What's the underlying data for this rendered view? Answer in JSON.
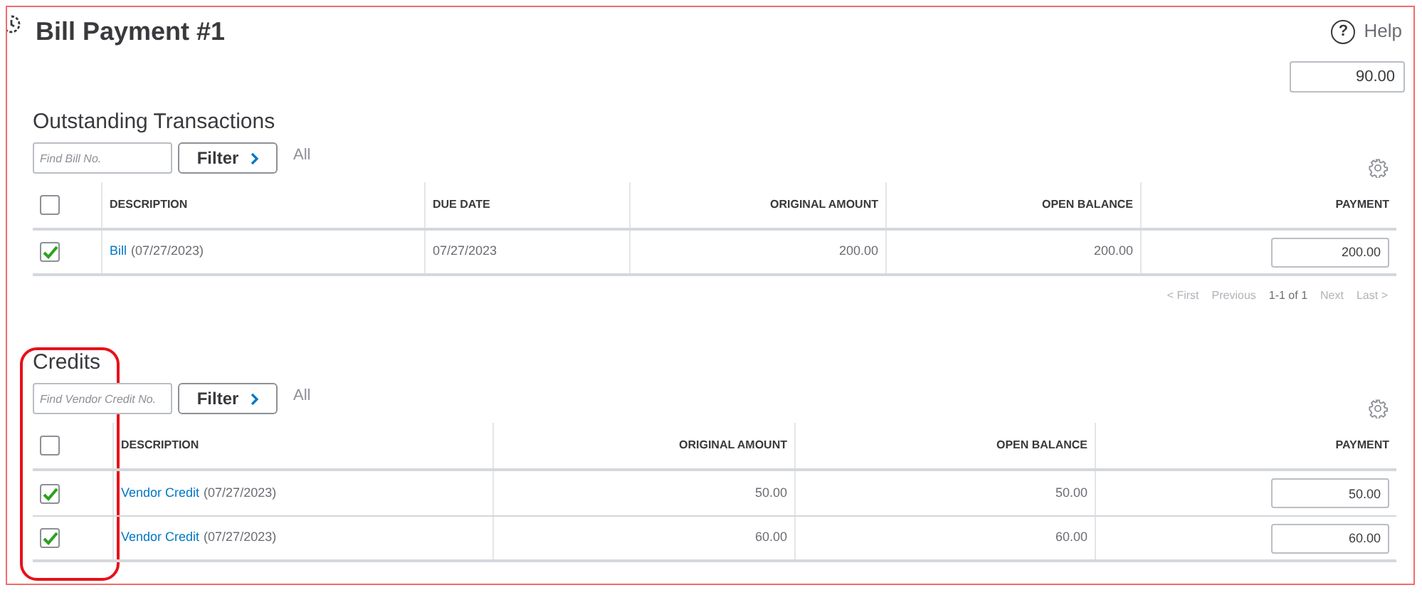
{
  "header": {
    "title": "Bill Payment #1",
    "help_glyph": "?",
    "help_label": "Help",
    "amount": "90.00"
  },
  "sections": [
    {
      "title": "Outstanding Transactions",
      "search_placeholder": "Find Bill No.",
      "filter_label": "Filter",
      "all_label": "All",
      "select_all": {
        "checked": false
      },
      "columns": [
        "DESCRIPTION",
        "DUE DATE",
        "ORIGINAL AMOUNT",
        "OPEN BALANCE",
        "PAYMENT"
      ],
      "rows": [
        {
          "checked": true,
          "cells": [
            {
              "kind": "link",
              "link": "Bill",
              "text": "(07/27/2023)"
            },
            {
              "kind": "text",
              "text": "07/27/2023"
            },
            {
              "kind": "amount",
              "text": "200.00"
            },
            {
              "kind": "amount",
              "text": "200.00"
            },
            {
              "kind": "input",
              "text": "200.00"
            }
          ]
        }
      ],
      "pagination": [
        {
          "label": "< First",
          "disabled": true
        },
        {
          "label": "Previous",
          "disabled": true
        },
        {
          "label": "1-1 of 1",
          "disabled": false
        },
        {
          "label": "Next",
          "disabled": true
        },
        {
          "label": "Last >",
          "disabled": true
        }
      ]
    },
    {
      "title": "Credits",
      "search_placeholder": "Find Vendor Credit No.",
      "filter_label": "Filter",
      "all_label": "All",
      "select_all": {
        "checked": false
      },
      "columns": [
        "DESCRIPTION",
        "ORIGINAL AMOUNT",
        "OPEN BALANCE",
        "PAYMENT"
      ],
      "rows": [
        {
          "checked": true,
          "cells": [
            {
              "kind": "link",
              "link": "Vendor Credit",
              "text": "(07/27/2023)"
            },
            {
              "kind": "amount",
              "text": "50.00"
            },
            {
              "kind": "amount",
              "text": "50.00"
            },
            {
              "kind": "input",
              "text": "50.00"
            }
          ]
        },
        {
          "checked": true,
          "cells": [
            {
              "kind": "link",
              "link": "Vendor Credit",
              "text": "(07/27/2023)"
            },
            {
              "kind": "amount",
              "text": "60.00"
            },
            {
              "kind": "amount",
              "text": "60.00"
            },
            {
              "kind": "input",
              "text": "60.00"
            }
          ]
        }
      ]
    }
  ]
}
